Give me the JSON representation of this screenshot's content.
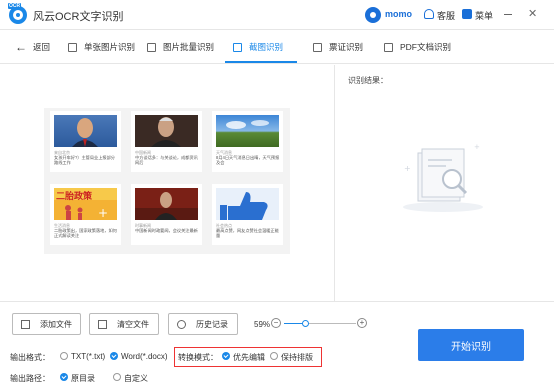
{
  "app": {
    "title": "风云OCR文字识别",
    "logo_badge": "OCR",
    "user": "momo",
    "service": "客服",
    "menu": "菜单"
  },
  "nav": {
    "back": "返回",
    "items": [
      {
        "label": "单张图片识别",
        "icon": "image-icon"
      },
      {
        "label": "图片批量识别",
        "icon": "images-icon"
      },
      {
        "label": "截图识别",
        "icon": "crop-icon",
        "active": true
      },
      {
        "label": "票证识别",
        "icon": "ticket-icon"
      },
      {
        "label": "PDF文档识别",
        "icon": "pdf-icon"
      }
    ]
  },
  "capture": {
    "cards": [
      {
        "src": "来自北京",
        "text": "女孩开车好?）主管局业上报部分路线工作"
      },
      {
        "src": "中国新闻",
        "text": "中方谈话多：与关谈论，成都资讯网后"
      },
      {
        "src": "天气消息",
        "text": "8月4日天气消息日出晴，天气预报及会"
      },
      {
        "src": "生活消息",
        "text": "二胎政策出，国家政策落地，如何正式解读关注"
      },
      {
        "src": "时事新闻",
        "text": "中国新闻时政要闻，会议关注最新"
      },
      {
        "src": "社会热点",
        "text": "最高点赞，网友点赞社会温暖正能量"
      }
    ],
    "banner_text": "二胎政策"
  },
  "result": {
    "label": "识别结果："
  },
  "toolbar": {
    "add_file": "添加文件",
    "clear_file": "清空文件",
    "history": "历史记录",
    "zoom": "59%",
    "zoom_level": 0.3
  },
  "output_format": {
    "label": "输出格式：",
    "txt": "TXT(*.txt)",
    "word": "Word(*.docx)",
    "selected": "word"
  },
  "convert_mode": {
    "label": "转换模式：",
    "opt1": "优先编辑",
    "opt2": "保持排版",
    "selected": "opt1"
  },
  "output_path": {
    "label": "输出路径：",
    "opt1": "原目录",
    "opt2": "自定义",
    "selected": "opt1"
  },
  "start_button": "开始识别",
  "colors": {
    "accent": "#1a88e8",
    "button": "#2b7de9",
    "highlight_border": "#e33"
  }
}
